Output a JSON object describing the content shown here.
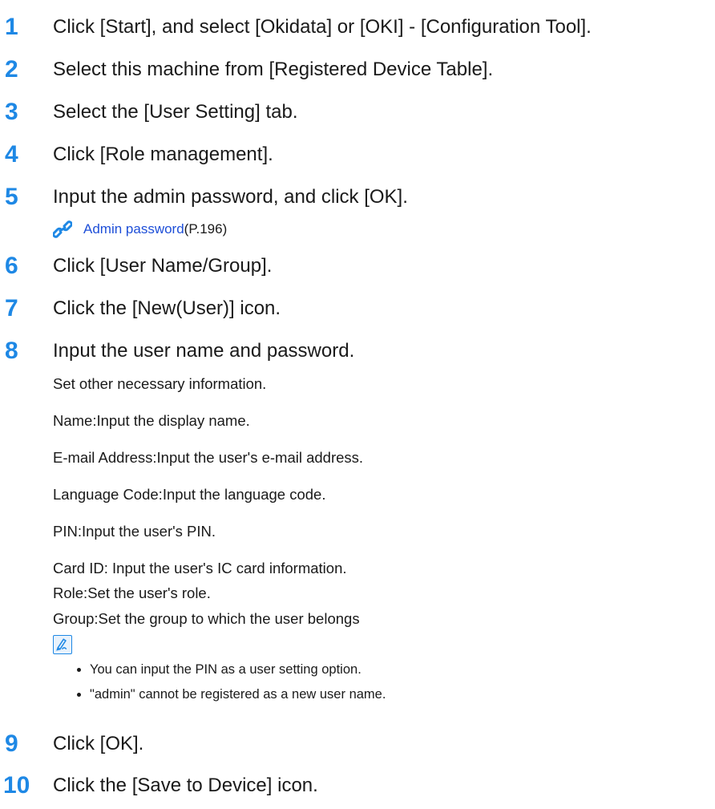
{
  "steps": [
    {
      "num": "1",
      "text": "Click [Start], and select [Okidata] or [OKI] - [Configuration Tool]."
    },
    {
      "num": "2",
      "text": "Select this machine from [Registered Device Table]."
    },
    {
      "num": "3",
      "text": "Select the [User Setting] tab."
    },
    {
      "num": "4",
      "text": "Click [Role management]."
    },
    {
      "num": "5",
      "text": "Input the admin password, and click [OK]."
    },
    {
      "num": "6",
      "text": "Click [User Name/Group]."
    },
    {
      "num": "7",
      "text": "Click the [New(User)] icon."
    },
    {
      "num": "8",
      "text": "Input the user name and password."
    },
    {
      "num": "9",
      "text": "Click [OK]."
    },
    {
      "num": "10",
      "text": "Click the [Save to Device] icon."
    }
  ],
  "link": {
    "text": "Admin password",
    "page": "(P.196)",
    "icon": "link-chain-icon"
  },
  "details": [
    "Set other necessary information.",
    "Name:Input the display name.",
    "E-mail Address:Input the user's e-mail address.",
    "Language Code:Input the language code.",
    "PIN:Input the user's PIN.",
    "Card ID: Input the user's IC card information.",
    "Role:Set the user's role.",
    "Group:Set the group to which the user belongs"
  ],
  "memo": {
    "icon": "memo-pencil-icon",
    "notes": [
      "You can input the PIN as a user setting option.",
      "\"admin\" cannot be registered as a new user name."
    ]
  },
  "colors": {
    "accent": "#1e88e5",
    "link": "#1e4fd8"
  }
}
